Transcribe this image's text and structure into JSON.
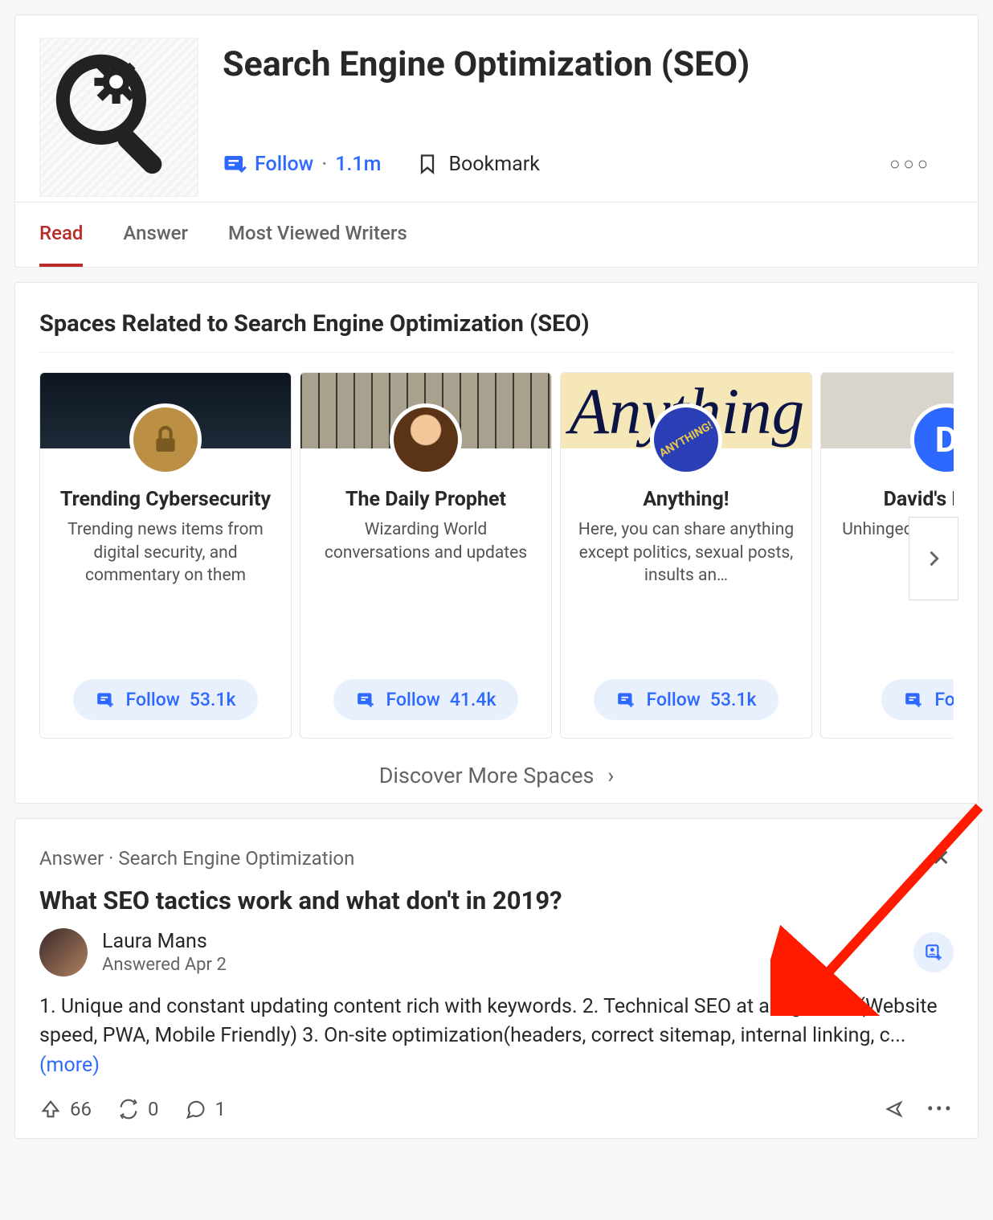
{
  "header": {
    "title": "Search Engine Optimization (SEO)",
    "follow_label": "Follow",
    "follower_count": "1.1m",
    "bookmark_label": "Bookmark"
  },
  "tabs": [
    {
      "label": "Read",
      "active": true
    },
    {
      "label": "Answer",
      "active": false
    },
    {
      "label": "Most Viewed Writers",
      "active": false
    }
  ],
  "spaces": {
    "heading": "Spaces Related to Search Engine Optimization (SEO)",
    "discover_label": "Discover More Spaces",
    "items": [
      {
        "name": "Trending Cybersecurity",
        "desc": "Trending news items from digital security, and commentary on them",
        "follow_label": "Follow",
        "count": "53.1k",
        "banner_color": "#1b1b1b",
        "avatar_bg": "#d2a34a"
      },
      {
        "name": "The Daily Prophet",
        "desc": "Wizarding World conversations and updates",
        "follow_label": "Follow",
        "count": "41.4k",
        "banner_color": "#8a8577",
        "avatar_bg": "#c97b36"
      },
      {
        "name": "Anything!",
        "desc": "Here, you can share anything except politics, sexual posts, insults an…",
        "follow_label": "Follow",
        "count": "53.1k",
        "banner_color": "#f5e7b8",
        "avatar_bg": "#2a3fb5"
      },
      {
        "name": "David's Digest",
        "desc": "Unhinged and Well-Hinged…",
        "follow_label": "Follow",
        "count": "",
        "banner_color": "#d7d3cb",
        "avatar_bg": "#2e69ff"
      }
    ]
  },
  "answer": {
    "type_label": "Answer",
    "topic_label": "Search Engine Optimization",
    "question": "What SEO tactics work and what don't in 2019?",
    "author_name": "Laura Mans",
    "answered_label": "Answered Apr 2",
    "body_text": "1. Unique and constant updating content rich with keywords. 2. Technical SEO at a high level(Website speed, PWA, Mobile Friendly) 3. On-site optimization(headers, correct sitemap, internal linking, c... ",
    "more_label": "(more)",
    "upvote_count": "66",
    "reshare_count": "0",
    "comment_count": "1"
  }
}
